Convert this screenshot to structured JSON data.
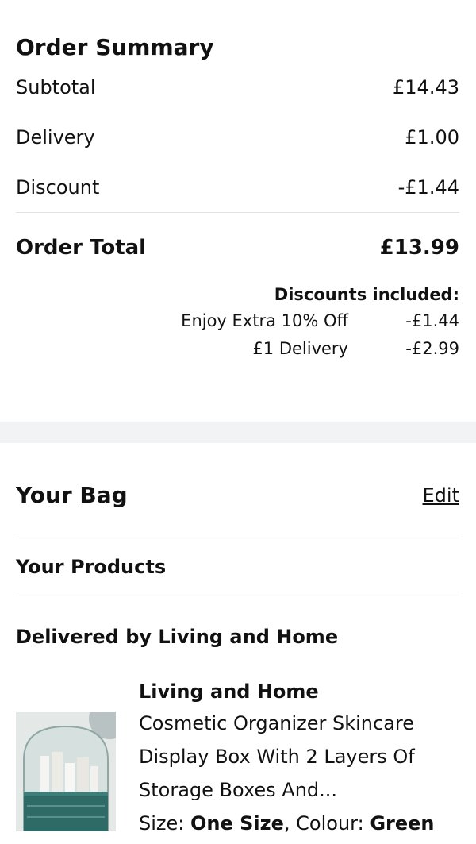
{
  "summary": {
    "title": "Order Summary",
    "subtotal_label": "Subtotal",
    "subtotal_value": "£14.43",
    "delivery_label": "Delivery",
    "delivery_value": "£1.00",
    "discount_label": "Discount",
    "discount_value": "-£1.44",
    "total_label": "Order Total",
    "total_value": "£13.99",
    "discounts_heading": "Discounts included:",
    "discounts": [
      {
        "name": "Enjoy Extra 10% Off",
        "value": "-£1.44"
      },
      {
        "name": "£1 Delivery",
        "value": "-£2.99"
      }
    ]
  },
  "bag": {
    "title": "Your Bag",
    "edit_label": "Edit",
    "products_title": "Your Products",
    "delivered_by": "Delivered by Living and Home",
    "product": {
      "seller": "Living and Home",
      "name": "Cosmetic Organizer Skincare Display Box With 2 Layers Of Storage Boxes And...",
      "size_label": "Size:",
      "size_value": "One Size",
      "colour_label": "Colour:",
      "colour_value": "Green"
    }
  },
  "colors": {
    "band": "#f2f3f4",
    "text": "#111111",
    "divider": "#e3e3e3",
    "product_box": "#2f6b66"
  }
}
